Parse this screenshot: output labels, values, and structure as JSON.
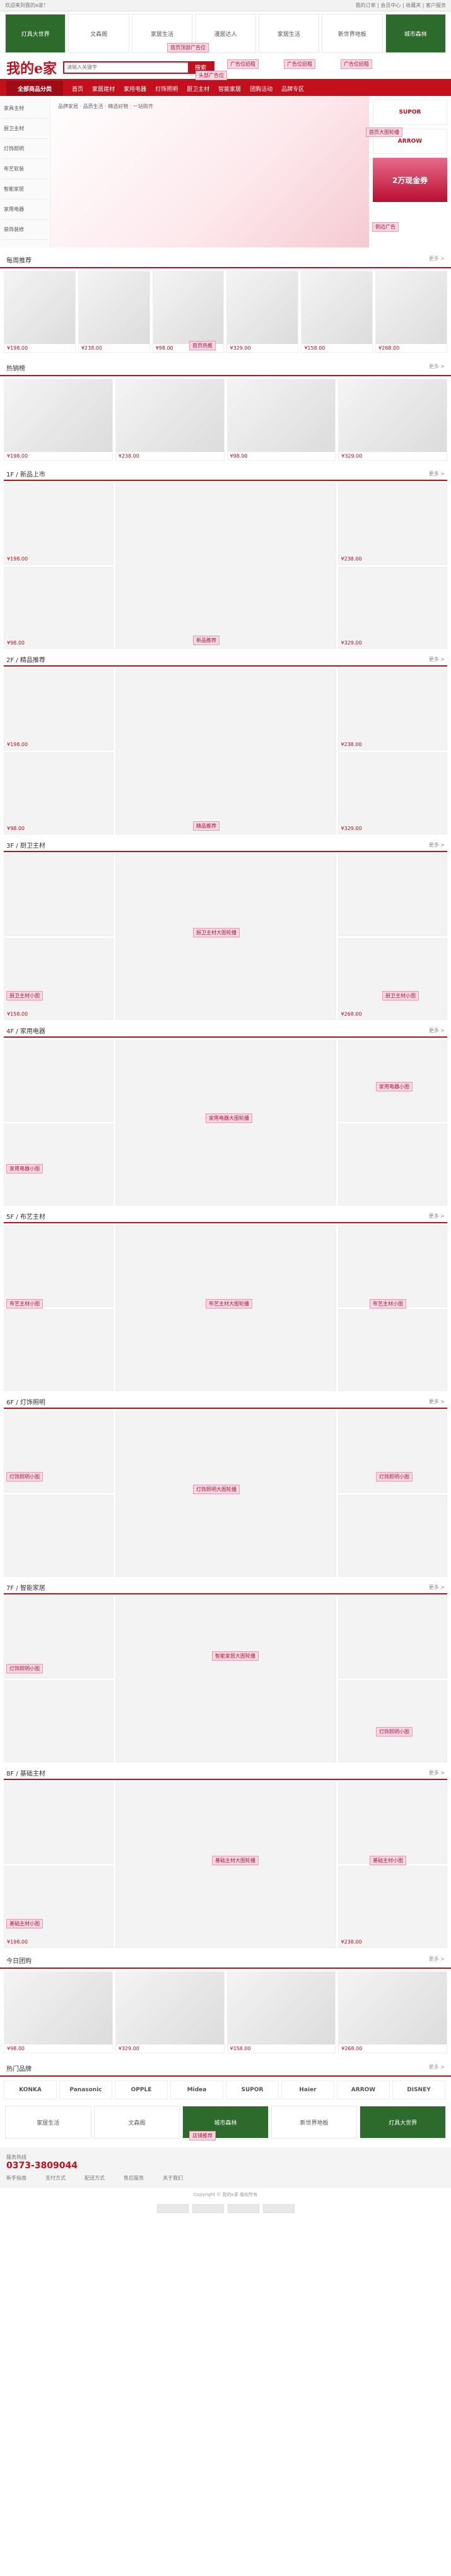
{
  "topbar": {
    "left": "欢迎来到我的e家！",
    "right": "我的订单 | 会员中心 | 收藏夹 | 客户服务"
  },
  "banners": [
    {
      "label": "灯具大世界",
      "style": "dark"
    },
    {
      "label": "文森阁",
      "style": "plain"
    },
    {
      "label": "家居生活",
      "style": "plain"
    },
    {
      "label": "漫居达人",
      "style": "plain"
    },
    {
      "label": "家居生活",
      "style": "plain"
    },
    {
      "label": "新世界地板",
      "style": "plain"
    },
    {
      "label": "城市森林",
      "style": "dark"
    }
  ],
  "callouts": {
    "top_banner": "首页顶部广告位",
    "header_ad": "头部广告位",
    "ad_space_1": "广告位招租",
    "ad_space_2": "广告位招租",
    "ad_space_3": "广告位招租",
    "hero_ad": "首页大图轮播",
    "side_ad": "侧边广告",
    "hot_rec": "首页热推",
    "new_rec": "新品推荐",
    "quality_rec": "精品推荐",
    "floor3_small_left": "厨卫主材小图",
    "floor3_big": "厨卫主材大图轮播",
    "floor3_small_right": "厨卫主材小图",
    "floor4_big": "家用电器大图轮播",
    "floor4_small_left": "家用电器小图",
    "floor4_small_right": "家用电器小图",
    "floor5_big": "布艺主材大图轮播",
    "floor5_small_left": "布艺主材小图",
    "floor5_small_right": "布艺主材小图",
    "floor6_big": "灯饰照明大图轮播",
    "floor6_small_left": "灯饰照明小图",
    "floor6_small_right": "灯饰照明小图",
    "floor7_big": "智能家居大图轮播",
    "floor7_small_left": "灯饰照明小图",
    "floor7_small_right": "灯饰照明小图",
    "floor8_big": "基础主材大图轮播",
    "floor8_small_left": "基础主材小图",
    "floor8_small_right": "基础主材小图",
    "bottom_ad": "店铺推荐"
  },
  "header": {
    "logo": "我的e家",
    "search_placeholder": "请输入关键字",
    "search_btn": "搜索"
  },
  "nav": {
    "category": "全部商品分类",
    "items": [
      "首页",
      "家居建材",
      "家用电器",
      "灯饰照明",
      "厨卫主材",
      "智能家居",
      "团购活动",
      "品牌专区"
    ]
  },
  "cat_menu": [
    "家具主材",
    "厨卫主材",
    "灯饰照明",
    "布艺软装",
    "智能家居",
    "家用电器",
    "装饰装修"
  ],
  "hero_text": "品牌家居 · 品质生活 · 精选好物 · 一站购齐",
  "hero_side": {
    "brand1": "SUPOR",
    "brand2": "ARROW",
    "side_ad": "2万现金券"
  },
  "sections": {
    "hot": "每周推荐",
    "trend": "热销榜",
    "floor1": "1F / 新品上市",
    "floor2": "2F / 精品推荐",
    "floor3": "3F / 厨卫主材",
    "floor4": "4F / 家用电器",
    "floor5": "5F / 布艺主材",
    "floor6": "6F / 灯饰照明",
    "floor7": "7F / 智能家居",
    "floor8": "8F / 基础主材",
    "brands": "热门品牌",
    "today": "今日团购",
    "more": "更多 >"
  },
  "prices": [
    "¥198.00",
    "¥238.00",
    "¥98.00",
    "¥329.00",
    "¥158.00",
    "¥268.00"
  ],
  "brands": [
    "KONKA",
    "Panasonic",
    "OPPLE",
    "Midea",
    "SUPOR",
    "Haier",
    "ARROW",
    "DISNEY"
  ],
  "footer": {
    "hotline_label": "服务热线",
    "hotline": "0373-3809044",
    "cols": [
      "新手指南",
      "支付方式",
      "配送方式",
      "售后服务",
      "关于我们"
    ],
    "copyright": "Copyright © 我的e家 版权所有"
  }
}
